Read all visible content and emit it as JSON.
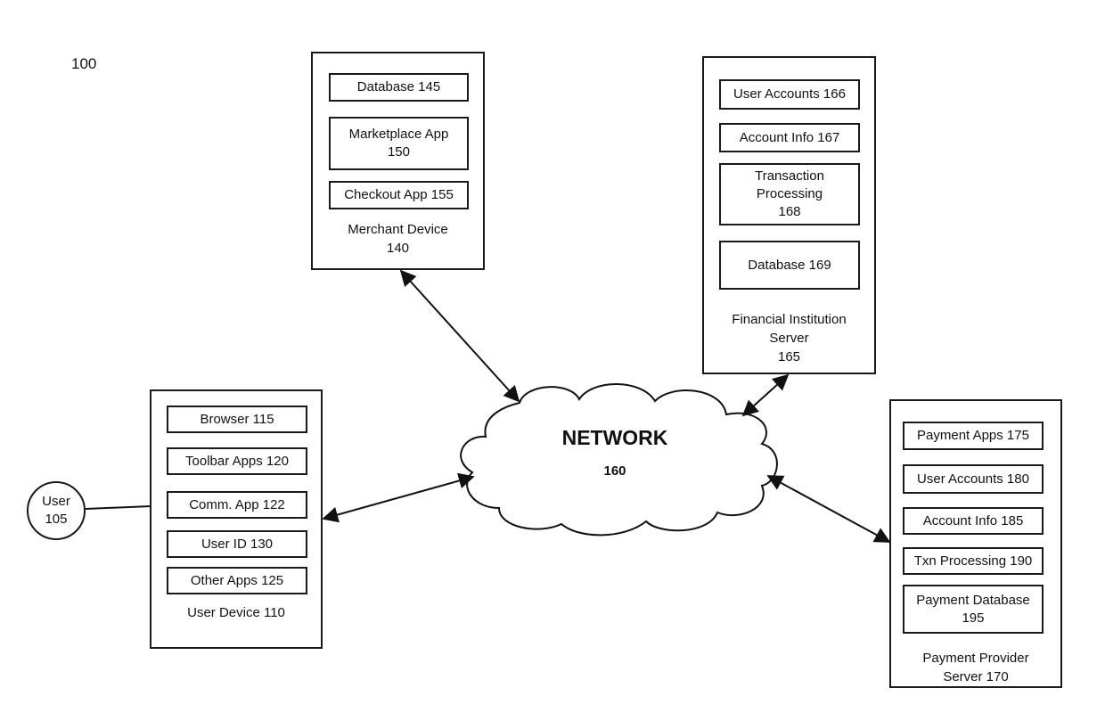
{
  "figure_label": "100",
  "user": {
    "label": "User\n105"
  },
  "network": {
    "title": "NETWORK",
    "number": "160"
  },
  "merchant_device": {
    "caption": "Merchant Device\n140",
    "components": [
      "Database 145",
      "Marketplace App\n150",
      "Checkout App 155"
    ]
  },
  "financial_institution_server": {
    "caption": "Financial Institution\nServer\n165",
    "components": [
      "User Accounts 166",
      "Account Info 167",
      "Transaction\nProcessing\n168",
      "Database 169"
    ]
  },
  "user_device": {
    "caption": "User Device 110",
    "components": [
      "Browser 115",
      "Toolbar Apps 120",
      "Comm. App 122",
      "User ID 130",
      "Other Apps 125"
    ]
  },
  "payment_provider_server": {
    "caption": "Payment Provider\nServer 170",
    "components": [
      "Payment Apps 175",
      "User Accounts 180",
      "Account Info 185",
      "Txn Processing 190",
      "Payment Database\n195"
    ]
  },
  "connections": [
    {
      "from": "Merchant Device 140",
      "to": "Network 160",
      "type": "bidirectional"
    },
    {
      "from": "Financial Institution Server 165",
      "to": "Network 160",
      "type": "bidirectional"
    },
    {
      "from": "User Device 110",
      "to": "Network 160",
      "type": "bidirectional"
    },
    {
      "from": "Payment Provider Server 170",
      "to": "Network 160",
      "type": "bidirectional"
    },
    {
      "from": "User 105",
      "to": "User Device 110",
      "type": "line"
    }
  ]
}
